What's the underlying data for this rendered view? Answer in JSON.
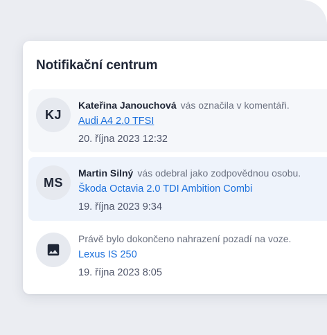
{
  "panel": {
    "title": "Notifikační centrum"
  },
  "notifications": [
    {
      "avatar_initials": "KJ",
      "actor": "Kateřina Janouchová",
      "action": "vás označila v komentáři.",
      "link": "Audi A4 2.0 TFSI",
      "timestamp": "20. října 2023 12:32"
    },
    {
      "avatar_initials": "MS",
      "actor": "Martin Silný",
      "action": "vás odebral jako zodpovědnou osobu.",
      "link": "Škoda Octavia 2.0 TDI Ambition Combi",
      "timestamp": "19. října 2023 9:34"
    },
    {
      "avatar_icon": "image-icon",
      "action": "Právě bylo dokončeno nahrazení pozadí na voze.",
      "link": "Lexus IS 250",
      "timestamp": "19. října 2023 8:05"
    }
  ],
  "colors": {
    "link": "#1a6fdc",
    "selected_row": "#eef3fb",
    "hover_row": "#f5f7fa",
    "backdrop": "#ebedf2"
  }
}
